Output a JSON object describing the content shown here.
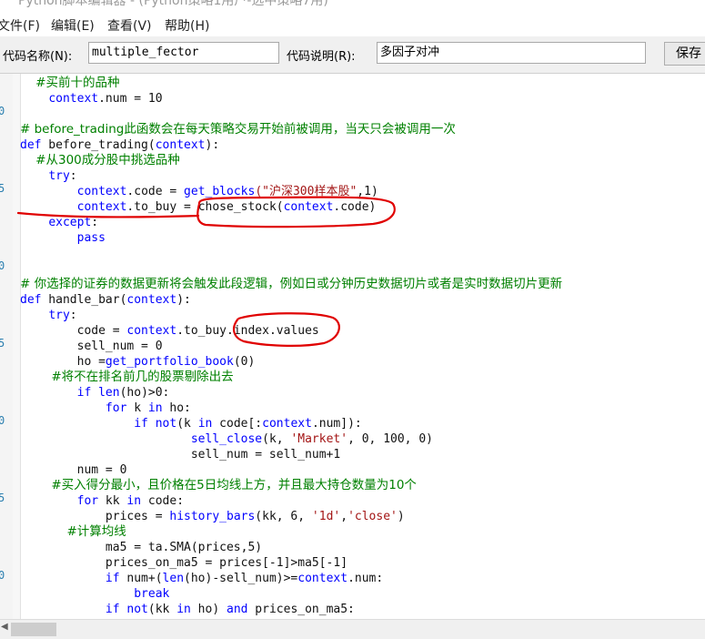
{
  "window": {
    "title": "Python脚本编辑器 - (Python策略1用户-选中策略7用) "
  },
  "menu": [
    {
      "label": "文件(F)"
    },
    {
      "label": "编辑(E)"
    },
    {
      "label": "查看(V)"
    },
    {
      "label": "帮助(H)"
    }
  ],
  "form": {
    "code_name_label": "代码名称(N):",
    "code_name_value": "multiple_fector",
    "code_desc_label": "代码说明(R):",
    "code_desc_value": "多因子对冲",
    "save_label": "保存"
  },
  "editor": {
    "gutter_numbers": [
      "0",
      "5",
      "0",
      "5",
      "0",
      "5",
      "0"
    ],
    "lines": [
      [
        [
          "cm",
          "    #买前十的品种"
        ]
      ],
      [
        [
          "nm",
          "    "
        ],
        [
          "kw",
          "context"
        ],
        [
          "nm",
          ".num = 10"
        ]
      ],
      [],
      [
        [
          "cm",
          "# before_trading此函数会在每天策略交易开始前被调用，当天只会被调用一次"
        ]
      ],
      [
        [
          "kw",
          "def"
        ],
        [
          "nm",
          " before_trading("
        ],
        [
          "kw",
          "context"
        ],
        [
          "nm",
          "):"
        ]
      ],
      [
        [
          "cm",
          "    #从300成分股中挑选品种"
        ]
      ],
      [
        [
          "nm",
          "    "
        ],
        [
          "kw",
          "try"
        ],
        [
          "nm",
          ":"
        ]
      ],
      [
        [
          "nm",
          "        "
        ],
        [
          "kw",
          "context"
        ],
        [
          "nm",
          ".code = "
        ],
        [
          "kw",
          "get_blocks"
        ],
        [
          "st",
          "(\"沪深300样本股\""
        ],
        [
          "nm",
          ",1)"
        ]
      ],
      [
        [
          "nm",
          "        "
        ],
        [
          "kw",
          "context"
        ],
        [
          "nm",
          ".to_buy = chose_stock("
        ],
        [
          "kw",
          "context"
        ],
        [
          "nm",
          ".code)"
        ]
      ],
      [
        [
          "nm",
          "    "
        ],
        [
          "kw",
          "except"
        ],
        [
          "nm",
          ":"
        ]
      ],
      [
        [
          "nm",
          "        "
        ],
        [
          "kw",
          "pass"
        ]
      ],
      [],
      [],
      [
        [
          "cm",
          "# 你选择的证券的数据更新将会触发此段逻辑，例如日或分钟历史数据切片或者是实时数据切片更新"
        ]
      ],
      [
        [
          "kw",
          "def"
        ],
        [
          "nm",
          " handle_bar("
        ],
        [
          "kw",
          "context"
        ],
        [
          "nm",
          "):"
        ]
      ],
      [
        [
          "nm",
          "    "
        ],
        [
          "kw",
          "try"
        ],
        [
          "nm",
          ":"
        ]
      ],
      [
        [
          "nm",
          "        code = "
        ],
        [
          "kw",
          "context"
        ],
        [
          "nm",
          ".to_buy.index.values"
        ]
      ],
      [
        [
          "nm",
          "        sell_num = 0"
        ]
      ],
      [
        [
          "nm",
          "        ho ="
        ],
        [
          "kw",
          "get_portfolio_book"
        ],
        [
          "nm",
          "(0)"
        ]
      ],
      [
        [
          "cm",
          "        #将不在排名前几的股票剔除出去"
        ]
      ],
      [
        [
          "nm",
          "        "
        ],
        [
          "kw",
          "if len"
        ],
        [
          "nm",
          "(ho)>0:"
        ]
      ],
      [
        [
          "nm",
          "            "
        ],
        [
          "kw",
          "for"
        ],
        [
          "nm",
          " k "
        ],
        [
          "kw",
          "in"
        ],
        [
          "nm",
          " ho:"
        ]
      ],
      [
        [
          "nm",
          "                "
        ],
        [
          "kw",
          "if not"
        ],
        [
          "nm",
          "(k "
        ],
        [
          "kw",
          "in"
        ],
        [
          "nm",
          " code[:"
        ],
        [
          "kw",
          "context"
        ],
        [
          "nm",
          ".num]):"
        ]
      ],
      [
        [
          "nm",
          "                        "
        ],
        [
          "kw",
          "sell_close"
        ],
        [
          "nm",
          "(k, "
        ],
        [
          "st",
          "'Market'"
        ],
        [
          "nm",
          ", 0, 100, 0)"
        ]
      ],
      [
        [
          "nm",
          "                        sell_num = sell_num+1"
        ]
      ],
      [
        [
          "nm",
          "        num = 0"
        ]
      ],
      [
        [
          "cm",
          "        #买入得分最小，且价格在5日均线上方，并且最大持仓数量为10个"
        ]
      ],
      [
        [
          "nm",
          "        "
        ],
        [
          "kw",
          "for"
        ],
        [
          "nm",
          " kk "
        ],
        [
          "kw",
          "in"
        ],
        [
          "nm",
          " code:"
        ]
      ],
      [
        [
          "nm",
          "            prices = "
        ],
        [
          "kw",
          "history_bars"
        ],
        [
          "nm",
          "(kk, 6, "
        ],
        [
          "st",
          "'1d'"
        ],
        [
          "nm",
          ","
        ],
        [
          "st",
          "'close'"
        ],
        [
          "nm",
          ")"
        ]
      ],
      [
        [
          "cm",
          "            #计算均线"
        ]
      ],
      [
        [
          "nm",
          "            ma5 = ta.SMA(prices,5)"
        ]
      ],
      [
        [
          "nm",
          "            prices_on_ma5 = prices[-1]>ma5[-1]"
        ]
      ],
      [
        [
          "nm",
          "            "
        ],
        [
          "kw",
          "if"
        ],
        [
          "nm",
          " num+("
        ],
        [
          "kw",
          "len"
        ],
        [
          "nm",
          "(ho)-sell_num)>="
        ],
        [
          "kw",
          "context"
        ],
        [
          "nm",
          ".num:"
        ]
      ],
      [
        [
          "nm",
          "                "
        ],
        [
          "kw",
          "break"
        ]
      ],
      [
        [
          "nm",
          "            "
        ],
        [
          "kw",
          "if not"
        ],
        [
          "nm",
          "(kk "
        ],
        [
          "kw",
          "in"
        ],
        [
          "nm",
          " ho) "
        ],
        [
          "kw",
          "and"
        ],
        [
          "nm",
          " prices_on_ma5:"
        ]
      ]
    ]
  },
  "annotation_color": "#e00000"
}
